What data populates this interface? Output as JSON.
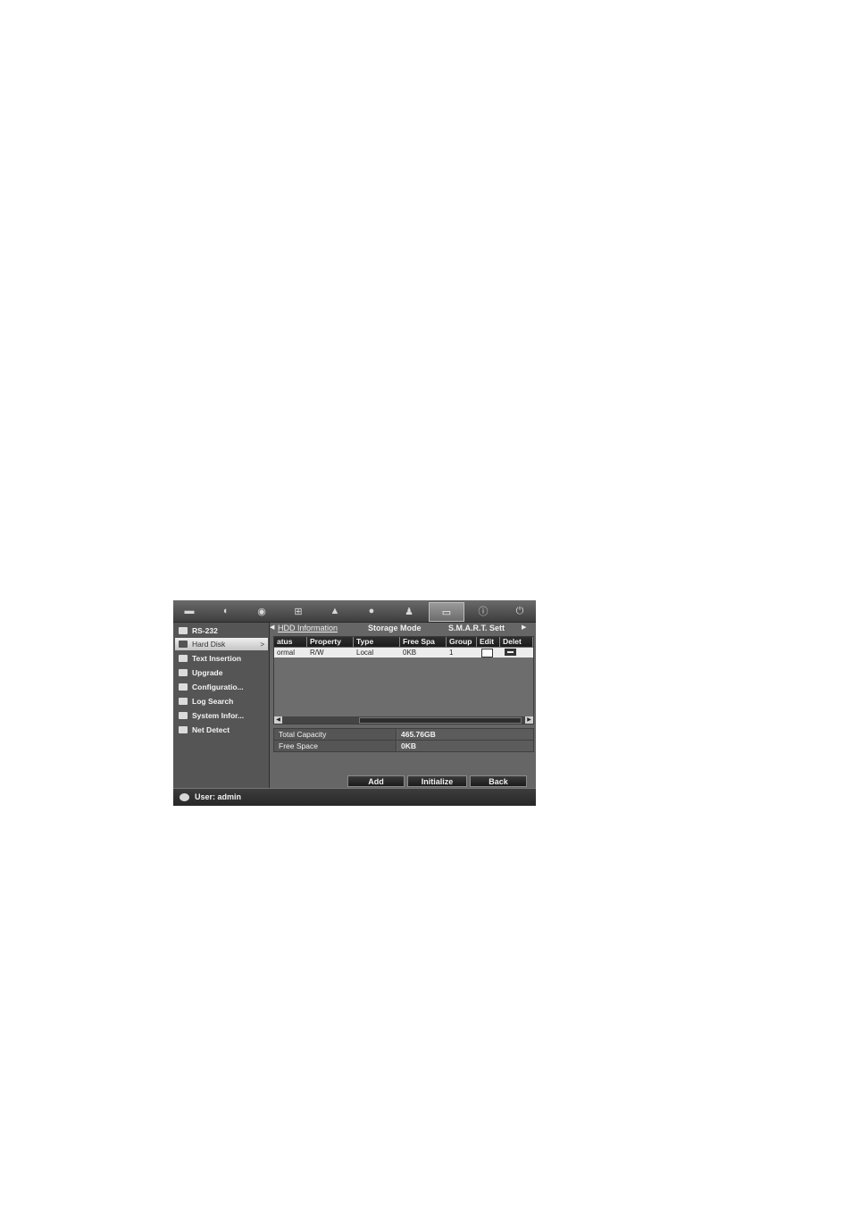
{
  "topbar": {
    "icons": [
      {
        "name": "live-view-icon",
        "glyph": "▬"
      },
      {
        "name": "camera-icon",
        "glyph": "◖"
      },
      {
        "name": "record-icon",
        "glyph": "◉"
      },
      {
        "name": "network-icon",
        "glyph": "⊞"
      },
      {
        "name": "alarm-icon",
        "glyph": "▲"
      },
      {
        "name": "device-icon",
        "glyph": "●"
      },
      {
        "name": "user-icon",
        "glyph": "♟"
      },
      {
        "name": "hdd-icon",
        "glyph": "▭",
        "active": true
      },
      {
        "name": "info-icon",
        "glyph": "ⓘ"
      },
      {
        "name": "power-icon",
        "glyph": "⏻"
      }
    ]
  },
  "sidebar": {
    "items": [
      {
        "label": "RS-232",
        "icon": "rs232-icon"
      },
      {
        "label": "Hard Disk",
        "icon": "hard-disk-icon",
        "selected": true,
        "arrow": ">"
      },
      {
        "label": "Text Insertion",
        "icon": "text-insertion-icon"
      },
      {
        "label": "Upgrade",
        "icon": "upgrade-icon"
      },
      {
        "label": "Configuratio...",
        "icon": "configuration-icon"
      },
      {
        "label": "Log Search",
        "icon": "log-search-icon"
      },
      {
        "label": "System Infor...",
        "icon": "system-info-icon"
      },
      {
        "label": "Net Detect",
        "icon": "net-detect-icon"
      }
    ]
  },
  "tabs": {
    "left_arrow": "◀",
    "right_arrow": "▶",
    "items": [
      {
        "label": "HDD Information",
        "active": true
      },
      {
        "label": "Storage Mode"
      },
      {
        "label": "S.M.A.R.T. Sett"
      }
    ]
  },
  "hdd_table": {
    "headers": [
      "atus",
      "Property",
      "Type",
      "Free Spa",
      "Group",
      "Edit",
      "Delet"
    ],
    "rows": [
      {
        "status": "ormal",
        "property": "R/W",
        "type": "Local",
        "free_space": "0KB",
        "group": "1"
      }
    ],
    "scroll_left": "◀",
    "scroll_right": "▶"
  },
  "summary": {
    "total_capacity_label": "Total Capacity",
    "total_capacity_value": "465.76GB",
    "free_space_label": "Free Space",
    "free_space_value": "0KB"
  },
  "buttons": {
    "add": "Add",
    "initialize": "Initialize",
    "back": "Back"
  },
  "status": {
    "user": "User: admin"
  }
}
